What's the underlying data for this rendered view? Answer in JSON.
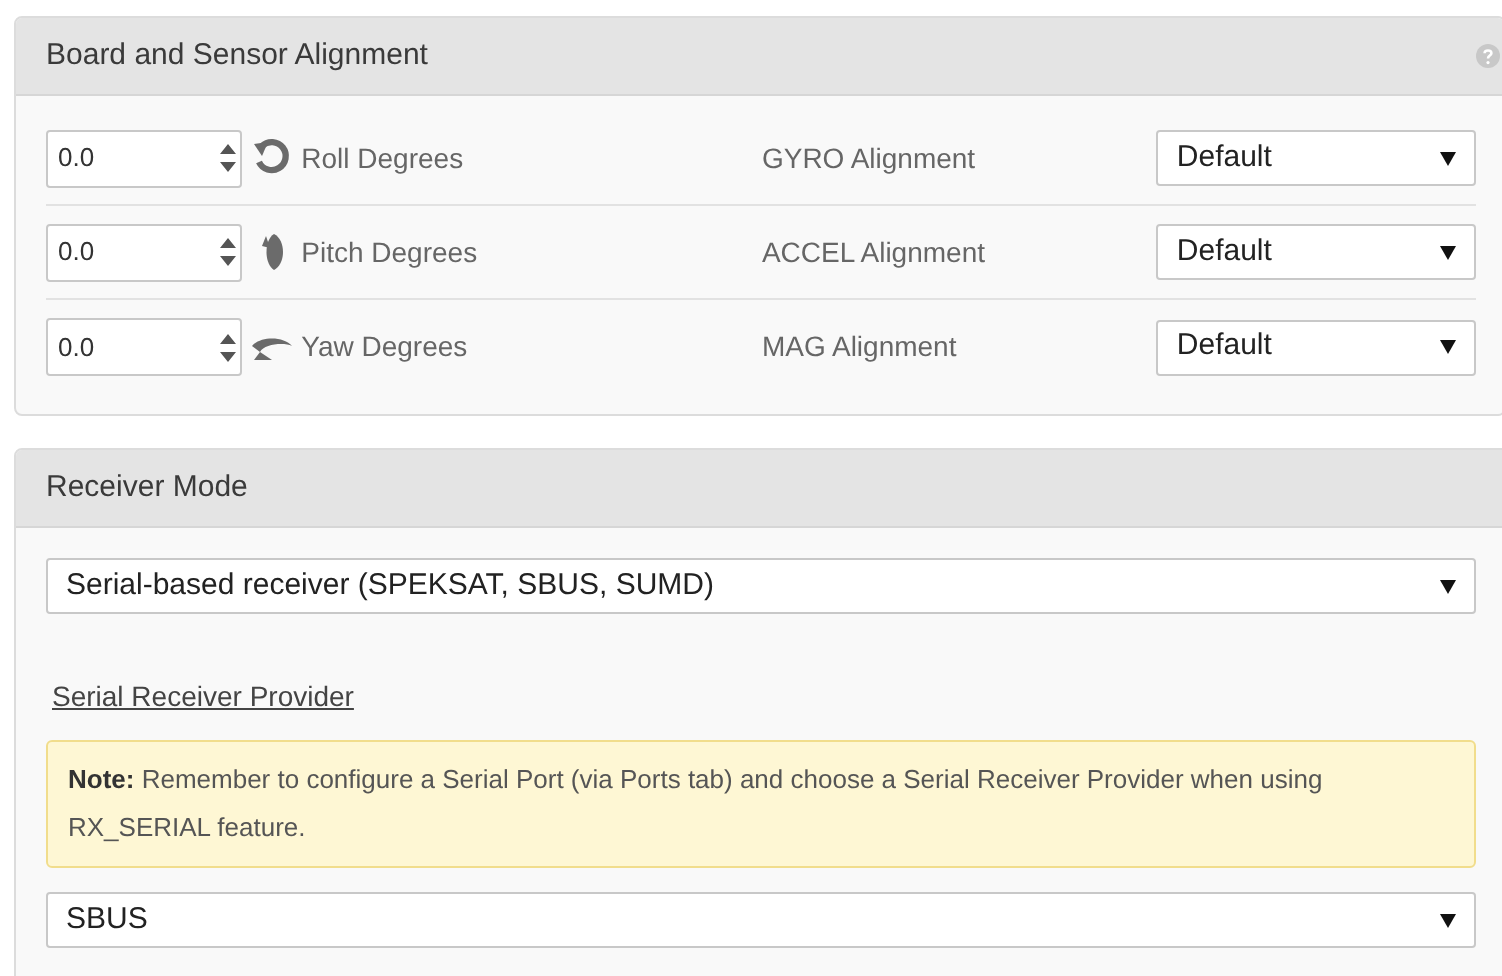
{
  "alignment_panel": {
    "title": "Board and Sensor Alignment",
    "rows": [
      {
        "kind": "roll",
        "value": "0.0",
        "label": "Roll Degrees",
        "sensor": "GYRO Alignment",
        "option": "Default"
      },
      {
        "kind": "pitch",
        "value": "0.0",
        "label": "Pitch Degrees",
        "sensor": "ACCEL Alignment",
        "option": "Default"
      },
      {
        "kind": "yaw",
        "value": "0.0",
        "label": "Yaw Degrees",
        "sensor": "MAG Alignment",
        "option": "Default"
      }
    ]
  },
  "receiver_panel": {
    "title": "Receiver Mode",
    "mode": "Serial-based receiver (SPEKSAT, SBUS, SUMD)",
    "provider_heading": "Serial Receiver Provider",
    "note": "**Note:** Remember to configure a Serial Port (via Ports tab) and choose a Serial Receiver Provider when using RX_SERIAL feature.",
    "provider": "SBUS"
  }
}
